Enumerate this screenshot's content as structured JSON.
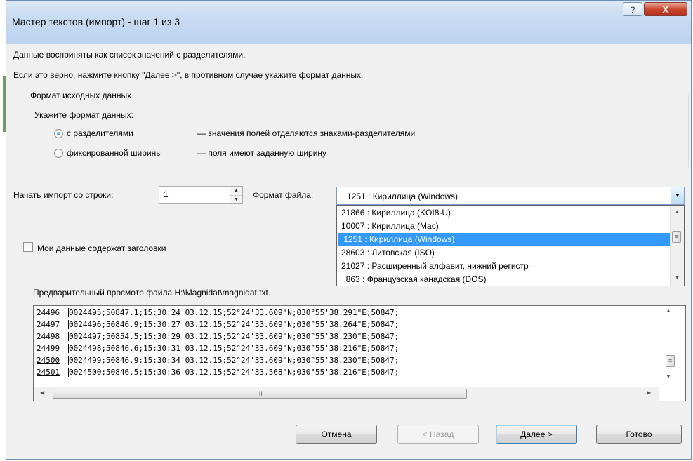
{
  "window": {
    "title": "Мастер текстов (импорт) - шаг 1 из 3",
    "help_glyph": "?",
    "close_glyph": "X"
  },
  "intro": {
    "line1": "Данные восприняты как список значений с разделителями.",
    "line2": "Если это верно, нажмите кнопку \"Далее >\", в противном случае укажите формат данных."
  },
  "source_format": {
    "group_title": "Формат исходных данных",
    "prompt": "Укажите формат данных:",
    "options": [
      {
        "label": "с разделителями",
        "description": "— значения полей отделяются знаками-разделителями",
        "checked": true
      },
      {
        "label": "фиксированной ширины",
        "description": "— поля имеют заданную ширину",
        "checked": false
      }
    ]
  },
  "import_start": {
    "label": "Начать импорт со строки:",
    "value": "1"
  },
  "file_format": {
    "label": "Формат файла:",
    "selected": "1251 : Кириллица (Windows)",
    "options": [
      "21866 : Кириллица (KOI8-U)",
      "10007 : Кириллица (Mac)",
      " 1251 : Кириллица (Windows)",
      "28603 : Литовская (ISO)",
      "21027 : Расширенный алфавит, нижний регистр",
      "  863 : Французская канадская (DOS)"
    ],
    "highlighted_index": 2
  },
  "headers_checkbox": {
    "label": "Мои данные содержат заголовки",
    "checked": false
  },
  "preview": {
    "label": "Предварительный просмотр файла H:\\Magnidat\\magnidat.txt.",
    "rows": [
      {
        "num": "24496",
        "text": "0024495;50847.1;15:30:24 03.12.15;52°24'33.609\"N;030°55'38.291\"E;50847;"
      },
      {
        "num": "24497",
        "text": "0024496;50846.9;15:30:27 03.12.15;52°24'33.609\"N;030°55'38.264\"E;50847;"
      },
      {
        "num": "24498",
        "text": "0024497;50854.5;15:30:29 03.12.15;52°24'33.609\"N;030°55'38.230\"E;50847;"
      },
      {
        "num": "24499",
        "text": "0024498;50846.6;15:30:31 03.12.15;52°24'33.609\"N;030°55'38.216\"E;50847;"
      },
      {
        "num": "24500",
        "text": "0024499;50846.9;15:30:34 03.12.15;52°24'33.609\"N;030°55'38.230\"E;50847;"
      },
      {
        "num": "24501",
        "text": "0024500;50846.5;15:30:36 03.12.15;52°24'33.568\"N;030°55'38.216\"E;50847;"
      }
    ]
  },
  "buttons": {
    "cancel": "Отмена",
    "back": "< Назад",
    "next": "Далее >",
    "finish": "Готово"
  },
  "colors": {
    "selection": "#3399ff",
    "close_button": "#c7432a",
    "titlebar": "#c8dbf1"
  },
  "icons": {
    "help": "help-icon",
    "close": "close-icon",
    "spin_up": "arrow-up-icon",
    "spin_down": "arrow-down-icon",
    "dropdown": "chevron-down-icon"
  }
}
